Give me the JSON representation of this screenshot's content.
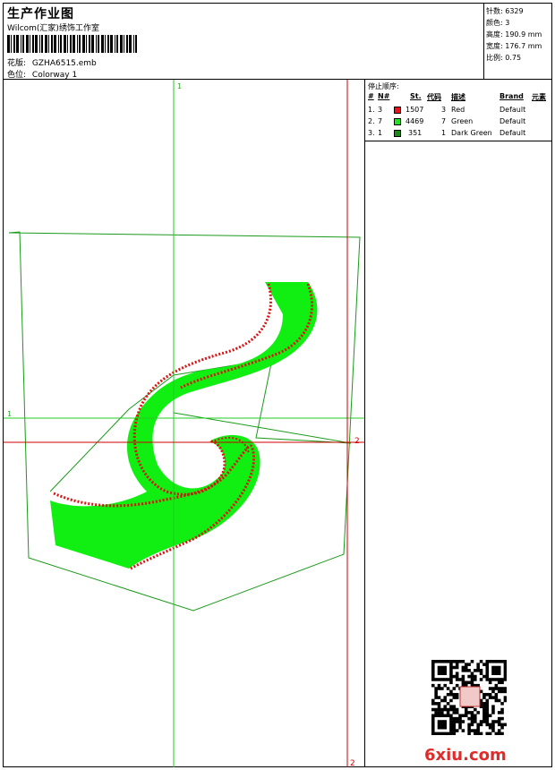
{
  "header": {
    "title": "生产作业图",
    "company": "Wilcom(汇家)绣饰工作室",
    "design_label": "花版:",
    "design_value": "GZHA6515.emb",
    "colorway_label": "色位:",
    "colorway_value": "Colorway 1"
  },
  "stats": [
    {
      "label": "针数:",
      "value": "6329"
    },
    {
      "label": "颜色:",
      "value": "3"
    },
    {
      "label": "高度:",
      "value": "190.9 mm"
    },
    {
      "label": "宽度:",
      "value": "176.7 mm"
    },
    {
      "label": "比例:",
      "value": "0.75"
    }
  ],
  "stop_sequence": {
    "title": "停止顺序:",
    "headers": {
      "seq": "#",
      "no": "N#",
      "stitches": "St.",
      "code": "代码",
      "desc": "描述",
      "brand": "Brand",
      "element": "元素"
    },
    "rows": [
      {
        "seq": "1.",
        "no": "3",
        "color": "#e8141b",
        "stitches": "1507",
        "code": "3",
        "desc": "Red",
        "brand": "Default"
      },
      {
        "seq": "2.",
        "no": "7",
        "color": "#22e022",
        "stitches": "4469",
        "code": "7",
        "desc": "Green",
        "brand": "Default"
      },
      {
        "seq": "3.",
        "no": "1",
        "color": "#1a8a1a",
        "stitches": "351",
        "code": "1",
        "desc": "Dark Green",
        "brand": "Default"
      }
    ]
  },
  "guides": {
    "v1_label": "1",
    "h1_label": "1",
    "h2_label": "2",
    "v2_label": "2"
  },
  "colors": {
    "guide_green": "#22cc22",
    "guide_red": "#cc0000",
    "fill_green": "#11ee11",
    "stitch_red": "#dd1111",
    "outline": "#1a9a1a"
  },
  "logo": {
    "text": "6xiu.com"
  },
  "icons": {
    "qr": "qr-code-icon",
    "seal": "seal-stamp-icon"
  }
}
